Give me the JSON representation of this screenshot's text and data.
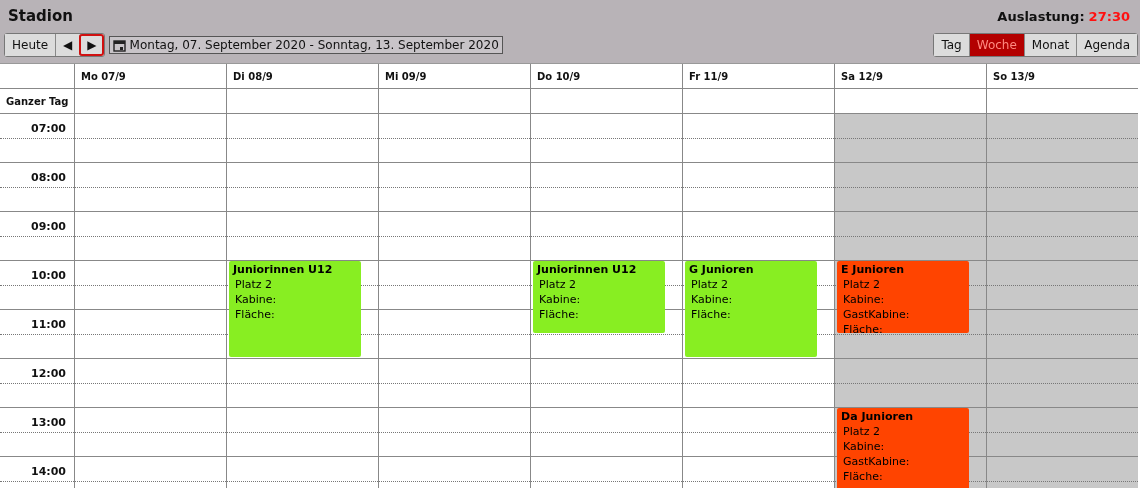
{
  "title": "Stadion",
  "utilization": {
    "label": "Auslastung:",
    "value": "27:30"
  },
  "toolbar": {
    "today": "Heute",
    "prev": {
      "glyph": "◀",
      "focused": false
    },
    "next": {
      "glyph": "▶",
      "focused": true
    },
    "date_range": "Montag, 07. September 2020 - Sonntag, 13. September 2020"
  },
  "views": [
    {
      "label": "Tag",
      "selected": false
    },
    {
      "label": "Woche",
      "selected": true
    },
    {
      "label": "Monat",
      "selected": false
    },
    {
      "label": "Agenda",
      "selected": false
    }
  ],
  "all_day_label": "Ganzer Tag",
  "hours": [
    "07:00",
    "08:00",
    "09:00",
    "10:00",
    "11:00",
    "12:00",
    "13:00",
    "14:00"
  ],
  "days": [
    {
      "label": "Mo 07/9",
      "weekend": false,
      "slots": [
        {
          "kind": "free"
        },
        {
          "kind": "free"
        },
        {
          "kind": "free"
        },
        {
          "kind": "free"
        },
        {
          "kind": "free"
        },
        {
          "kind": "free"
        },
        {
          "kind": "free"
        },
        {
          "kind": "free"
        }
      ]
    },
    {
      "label": "Di 08/9",
      "weekend": false,
      "slots": [
        {
          "kind": "free"
        },
        {
          "kind": "free"
        },
        {
          "kind": "free"
        },
        {
          "kind": "long",
          "title": "Juniorinnen U12",
          "color": "#88ee22",
          "lines": [
            "Platz 2",
            "Kabine:",
            "Fläche:"
          ]
        },
        {
          "kind": "free"
        },
        {
          "kind": "free"
        },
        {
          "kind": "free"
        },
        {
          "kind": "free"
        }
      ]
    },
    {
      "label": "Mi 09/9",
      "weekend": false,
      "slots": [
        {
          "kind": "free"
        },
        {
          "kind": "free"
        },
        {
          "kind": "free"
        },
        {
          "kind": "free"
        },
        {
          "kind": "free"
        },
        {
          "kind": "free"
        },
        {
          "kind": "free"
        },
        {
          "kind": "free"
        }
      ]
    },
    {
      "label": "Do 10/9",
      "weekend": false,
      "slots": [
        {
          "kind": "free"
        },
        {
          "kind": "free"
        },
        {
          "kind": "free"
        },
        {
          "kind": "short",
          "title": "Juniorinnen U12",
          "color": "#88ee22",
          "lines": [
            "Platz 2",
            "Kabine:",
            "Fläche:"
          ]
        },
        {
          "kind": "free"
        },
        {
          "kind": "free"
        },
        {
          "kind": "free"
        },
        {
          "kind": "free"
        }
      ]
    },
    {
      "label": "Fr 11/9",
      "weekend": false,
      "slots": [
        {
          "kind": "free"
        },
        {
          "kind": "free"
        },
        {
          "kind": "free"
        },
        {
          "kind": "long",
          "title": "G Junioren",
          "color": "#88ee22",
          "lines": [
            "Platz 2",
            "Kabine:",
            "Fläche:"
          ]
        },
        {
          "kind": "free"
        },
        {
          "kind": "free"
        },
        {
          "kind": "free"
        },
        {
          "kind": "free"
        }
      ]
    },
    {
      "label": "Sa 12/9",
      "weekend": true,
      "slots": [
        {
          "kind": "free"
        },
        {
          "kind": "free"
        },
        {
          "kind": "free"
        },
        {
          "kind": "short",
          "title": "E Junioren",
          "color": "#ff4400",
          "lines": [
            "Platz 2",
            "Kabine:",
            "GastKabine:",
            "Fläche:"
          ]
        },
        {
          "kind": "free"
        },
        {
          "kind": "free"
        },
        {
          "kind": "long",
          "title": "Da Junioren",
          "color": "#ff4400",
          "lines": [
            "Platz 2",
            "Kabine:",
            "GastKabine:",
            "Fläche:"
          ]
        },
        {
          "kind": "free"
        }
      ]
    },
    {
      "label": "So 13/9",
      "weekend": true,
      "slots": [
        {
          "kind": "free"
        },
        {
          "kind": "free"
        },
        {
          "kind": "free"
        },
        {
          "kind": "free"
        },
        {
          "kind": "free"
        },
        {
          "kind": "free"
        },
        {
          "kind": "free"
        },
        {
          "kind": "free"
        }
      ]
    }
  ]
}
